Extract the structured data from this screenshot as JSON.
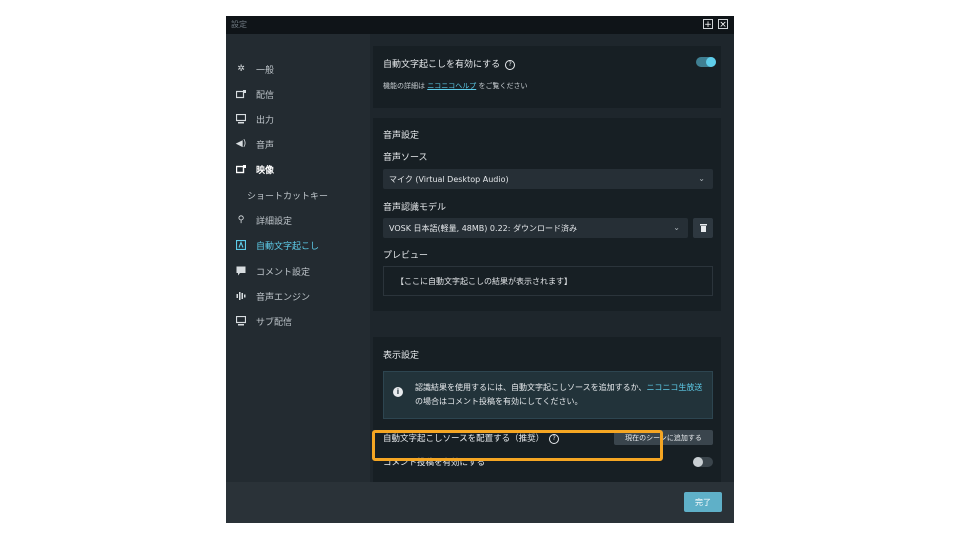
{
  "window": {
    "title": "設定"
  },
  "sidebar": {
    "items": [
      {
        "label": "一般",
        "icon": "gear-icon"
      },
      {
        "label": "配信",
        "icon": "broadcast-icon"
      },
      {
        "label": "出力",
        "icon": "output-icon"
      },
      {
        "label": "音声",
        "icon": "speaker-icon"
      },
      {
        "label": "映像",
        "icon": "video-icon"
      },
      {
        "label": "ショートカットキー",
        "icon": ""
      },
      {
        "label": "詳細設定",
        "icon": "wrench-icon"
      },
      {
        "label": "自動文字起こし",
        "icon": "transcription-icon"
      },
      {
        "label": "コメント設定",
        "icon": "comment-icon"
      },
      {
        "label": "音声エンジン",
        "icon": "audio-engine-icon"
      },
      {
        "label": "サブ配信",
        "icon": "sub-broadcast-icon"
      }
    ],
    "active_index": 7
  },
  "transcription": {
    "enable_label": "自動文字起こしを有効にする",
    "enabled": true,
    "help_prefix": "機能の詳細は",
    "help_link": "ニコニコヘルプ",
    "help_suffix": "をご覧ください"
  },
  "audio_settings": {
    "heading": "音声設定",
    "source_label": "音声ソース",
    "source_value": "マイク (Virtual Desktop Audio)",
    "model_label": "音声認識モデル",
    "model_value": "VOSK 日本語(軽量, 48MB) 0.22: ダウンロード済み",
    "preview_label": "プレビュー",
    "preview_text": "【ここに自動文字起こしの結果が表示されます】"
  },
  "display_settings": {
    "heading": "表示設定",
    "info_text_before": "認識結果を使用するには、自動文字起こしソースを追加するか、",
    "info_link": "ニコニコ生放送",
    "info_text_after": "の場合はコメント投稿を有効にしてください。",
    "place_source_label": "自動文字起こしソースを配置する（推奨）",
    "add_to_scene_button": "現在のシーンに追加する",
    "comment_post_label": "コメント投稿を有効にする",
    "comment_post_enabled": false
  },
  "footer": {
    "done_button": "完了"
  },
  "colors": {
    "accent": "#5ecdea",
    "highlight": "#f5a623",
    "done_button": "#5fb0c8"
  }
}
